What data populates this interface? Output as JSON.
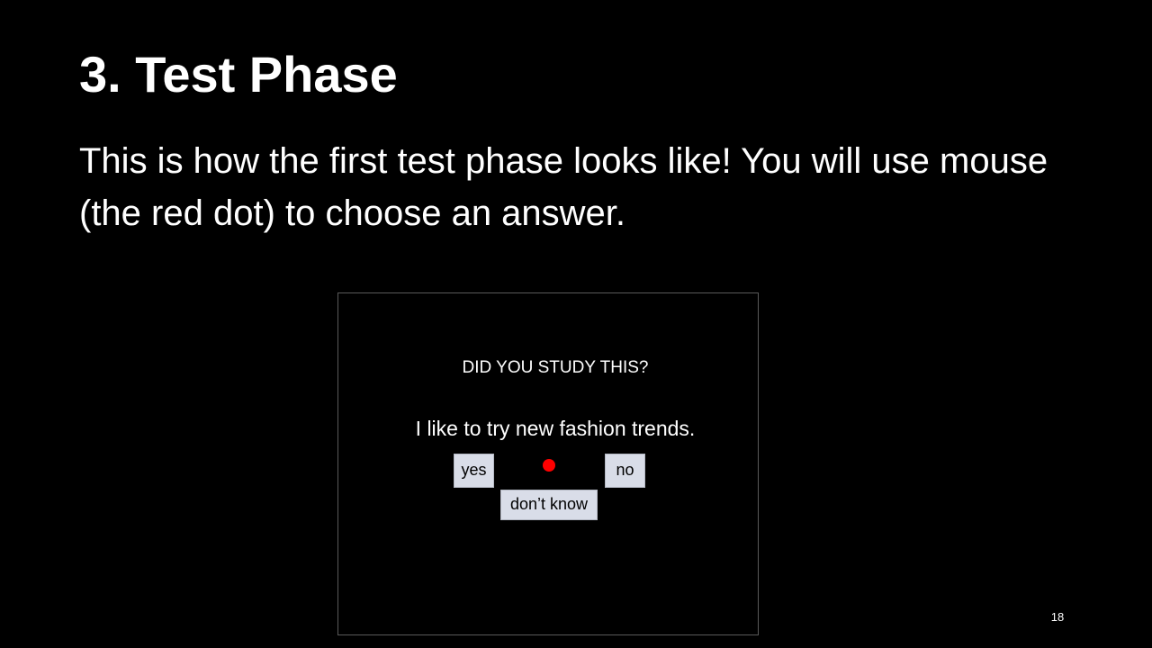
{
  "slide": {
    "title": "3. Test Phase",
    "body": "This is how the first test phase looks like! You will use mouse (the red dot) to choose an answer.",
    "page_number": "18"
  },
  "screen": {
    "prompt": "DID YOU STUDY THIS?",
    "statement": "I like to try new fashion trends.",
    "buttons": {
      "yes": "yes",
      "no": "no",
      "dont_know": "don’t know"
    },
    "cursor": {
      "icon": "red-dot-cursor-icon",
      "color": "#ff0000"
    }
  }
}
